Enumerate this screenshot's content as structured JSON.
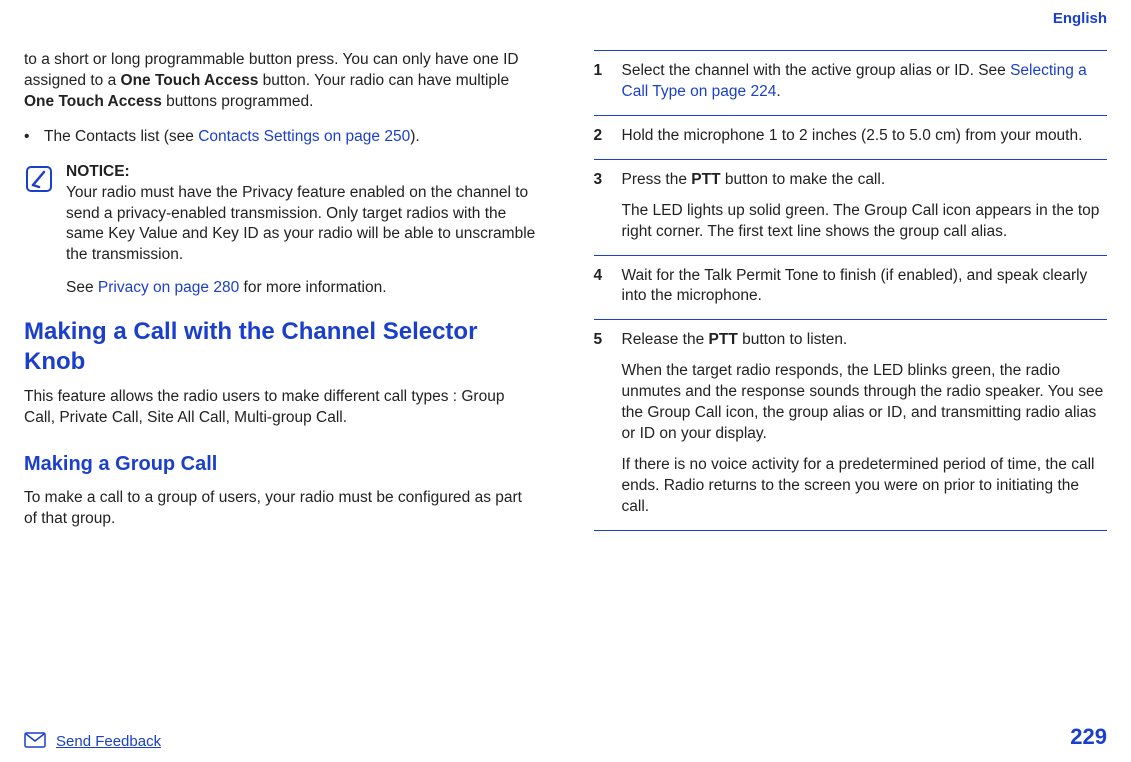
{
  "header": {
    "language": "English"
  },
  "left": {
    "intro_pre": "to a short or long programmable button press. You can only have one ID assigned to a ",
    "intro_bold1": "One Touch Access",
    "intro_mid": " button. Your radio can have multiple ",
    "intro_bold2": "One Touch Access",
    "intro_post": " buttons programmed.",
    "bullet_pre": "The Contacts list (see ",
    "bullet_link": "Contacts Settings on page 250",
    "bullet_post": ").",
    "notice_label": "NOTICE:",
    "notice_text": "Your radio must have the Privacy feature enabled on the channel to send a privacy-enabled transmission. Only target radios with the same Key Value and Key ID as your radio will be able to unscramble the transmission.",
    "notice_see_pre": "See ",
    "notice_see_link": "Privacy on page 280",
    "notice_see_post": " for more information.",
    "h2": "Making a Call with the Channel Selector Knob",
    "h2_desc": "This feature allows the radio users to make different call types : Group Call, Private Call, Site All Call, Multi-group Call.",
    "h3": "Making a Group Call",
    "h3_desc": "To make a call to a group of users, your radio must be configured as part of that group."
  },
  "right": {
    "steps": [
      {
        "num": "1",
        "paras": [
          {
            "segments": [
              {
                "t": "Select the channel with the active group alias or ID. See "
              },
              {
                "t": "Selecting a Call Type on page 224",
                "link": true
              },
              {
                "t": "."
              }
            ]
          }
        ]
      },
      {
        "num": "2",
        "paras": [
          {
            "segments": [
              {
                "t": "Hold the microphone 1 to 2 inches (2.5 to 5.0 cm) from your mouth."
              }
            ]
          }
        ]
      },
      {
        "num": "3",
        "paras": [
          {
            "segments": [
              {
                "t": "Press the "
              },
              {
                "t": "PTT",
                "bold": true
              },
              {
                "t": " button to make the call."
              }
            ]
          },
          {
            "segments": [
              {
                "t": "The LED lights up solid green. The Group Call icon appears in the top right corner. The first text line shows the group call alias."
              }
            ]
          }
        ]
      },
      {
        "num": "4",
        "paras": [
          {
            "segments": [
              {
                "t": "Wait for the Talk Permit Tone to finish (if enabled), and speak clearly into the microphone."
              }
            ]
          }
        ]
      },
      {
        "num": "5",
        "paras": [
          {
            "segments": [
              {
                "t": "Release the "
              },
              {
                "t": "PTT",
                "bold": true
              },
              {
                "t": " button to listen."
              }
            ]
          },
          {
            "segments": [
              {
                "t": "When the target radio responds, the LED blinks green, the radio unmutes and the response sounds through the radio speaker. You see the Group Call icon, the group alias or ID, and transmitting radio alias or ID on your display."
              }
            ]
          },
          {
            "segments": [
              {
                "t": "If there is no voice activity for a predetermined period of time, the call ends. Radio returns to the screen you were on prior to initiating the call."
              }
            ]
          }
        ]
      }
    ]
  },
  "footer": {
    "feedback": "Send Feedback",
    "page": "229"
  }
}
